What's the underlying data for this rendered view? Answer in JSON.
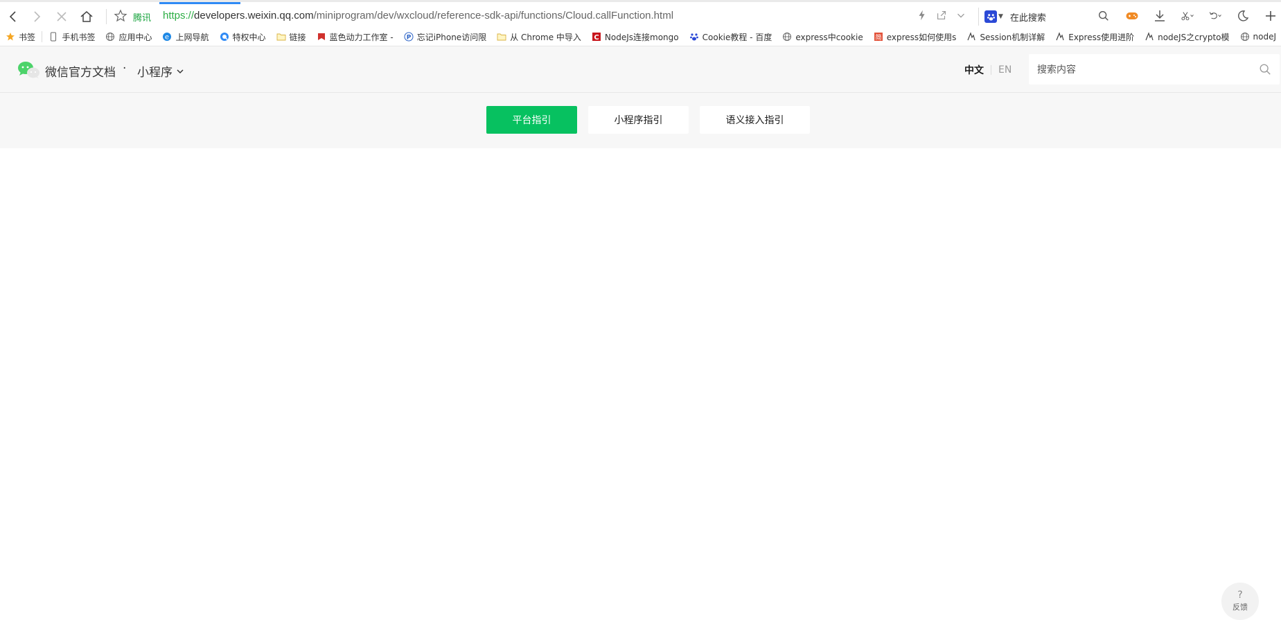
{
  "browser": {
    "site_label": "腾讯",
    "url": {
      "scheme": "https://",
      "host": "developers.weixin.qq.com",
      "path": "/miniprogram/dev/wxcloud/reference-sdk-api/functions/Cloud.callFunction.html"
    },
    "search_engine_placeholder": "在此搜索"
  },
  "bookmarks": [
    {
      "label": "书签",
      "icon": "star-icon"
    },
    {
      "label": "手机书签",
      "icon": "phone-icon"
    },
    {
      "label": "应用中心",
      "icon": "globe-icon"
    },
    {
      "label": "上网导航",
      "icon": "ie-icon"
    },
    {
      "label": "特权中心",
      "icon": "q-icon"
    },
    {
      "label": "链接",
      "icon": "folder-icon"
    },
    {
      "label": "蓝色动力工作室 -",
      "icon": "bookmark-icon"
    },
    {
      "label": "忘记iPhone访问限",
      "icon": "p-icon"
    },
    {
      "label": "从 Chrome 中导入",
      "icon": "folder-icon"
    },
    {
      "label": "NodeJs连接mongo",
      "icon": "c-icon"
    },
    {
      "label": "Cookie教程 - 百度",
      "icon": "baidu-icon"
    },
    {
      "label": "express中cookie",
      "icon": "globe-icon"
    },
    {
      "label": "express如何使用s",
      "icon": "jian-icon"
    },
    {
      "label": "Session机制详解",
      "icon": "tilde-icon"
    },
    {
      "label": "Express使用进阶",
      "icon": "tilde-icon"
    },
    {
      "label": "nodeJS之crypto模",
      "icon": "tilde-icon"
    },
    {
      "label": "nodeJ",
      "icon": "globe-icon"
    }
  ],
  "header": {
    "brand_title": "微信官方文档",
    "brand_separator": "·",
    "product": "小程序",
    "lang_zh": "中文",
    "lang_en": "EN",
    "search_placeholder": "搜索内容"
  },
  "guides": {
    "platform": "平台指引",
    "miniprogram": "小程序指引",
    "semantic": "语义接入指引"
  },
  "feedback": {
    "icon_text": "?",
    "label": "反馈"
  },
  "colors": {
    "brand_green": "#07c160",
    "progress_blue": "#2f8af5",
    "header_bg": "#f7f7f7"
  }
}
